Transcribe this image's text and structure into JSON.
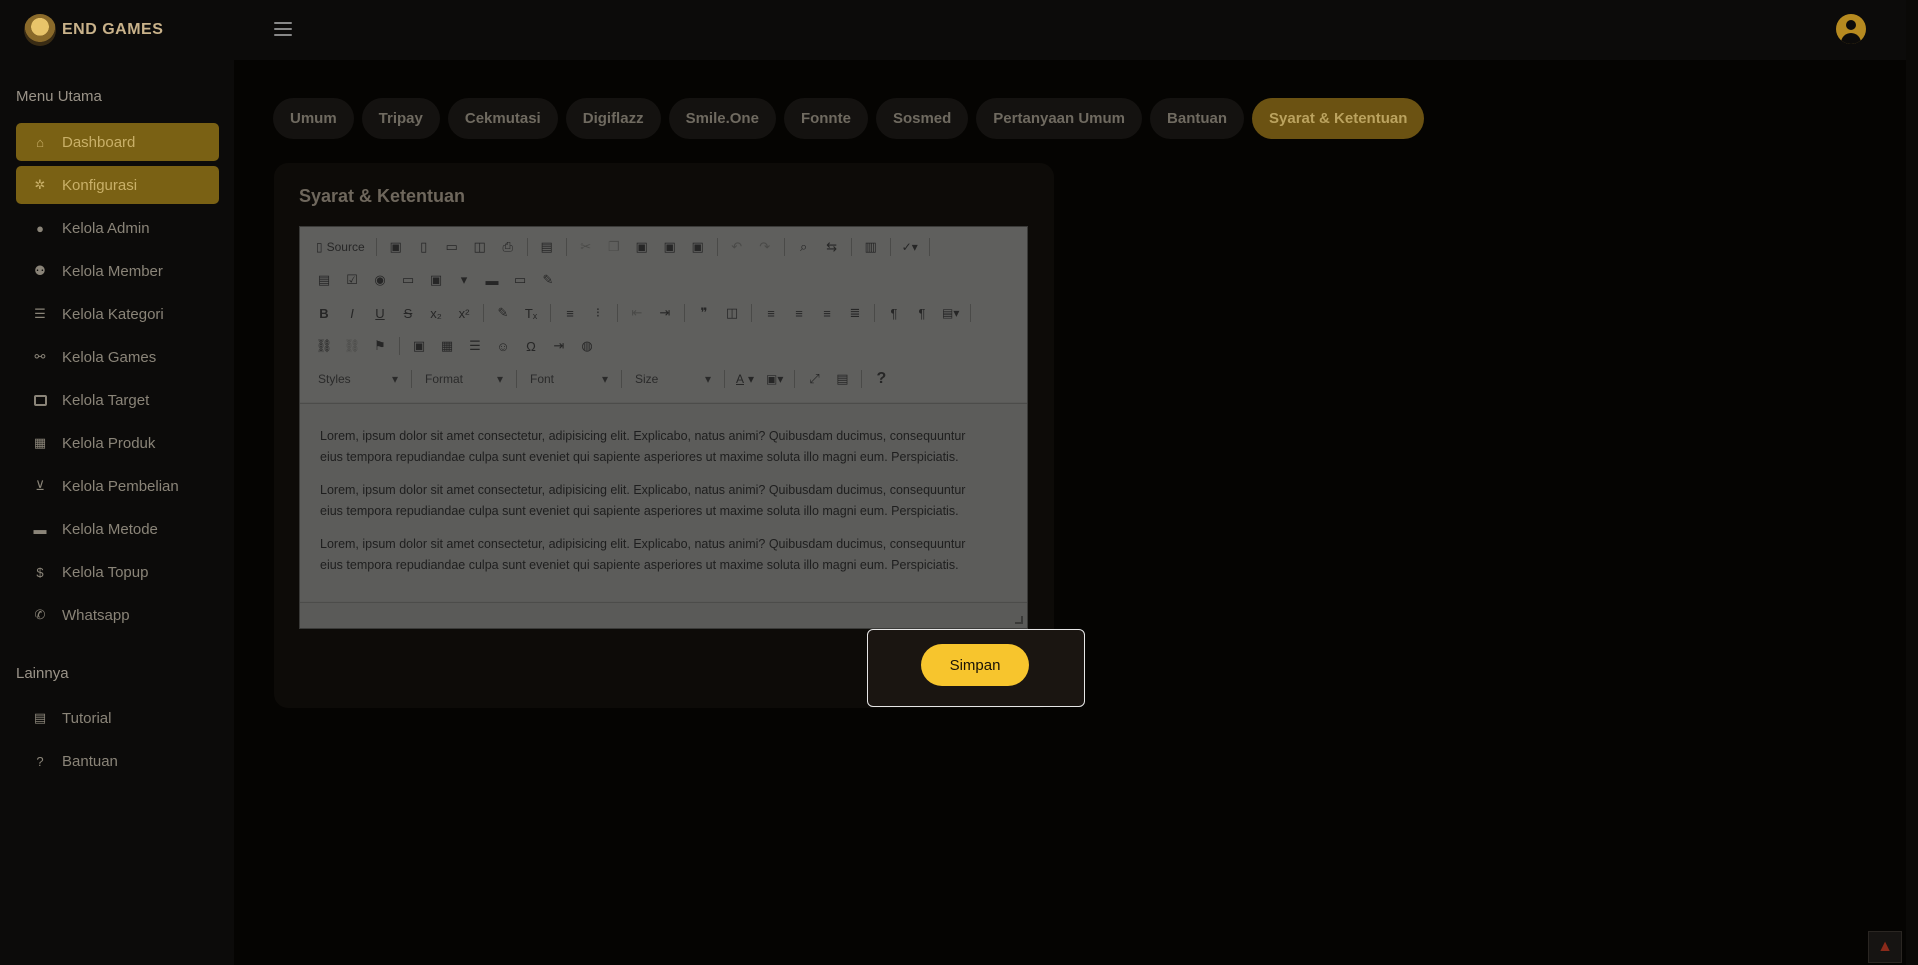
{
  "brand": {
    "name": "END GAMES"
  },
  "sidebar": {
    "heading_main": "Menu Utama",
    "heading_other": "Lainnya",
    "items": [
      {
        "label": "Dashboard",
        "icon": "home-icon"
      },
      {
        "label": "Konfigurasi",
        "icon": "gear-icon"
      },
      {
        "label": "Kelola Admin",
        "icon": "user-cog-icon"
      },
      {
        "label": "Kelola Member",
        "icon": "users-icon"
      },
      {
        "label": "Kelola Kategori",
        "icon": "list-icon"
      },
      {
        "label": "Kelola Games",
        "icon": "gamepad-icon"
      },
      {
        "label": "Kelola Target",
        "icon": "table-icon"
      },
      {
        "label": "Kelola Produk",
        "icon": "calendar-icon"
      },
      {
        "label": "Kelola Pembelian",
        "icon": "basket-icon"
      },
      {
        "label": "Kelola Metode",
        "icon": "credit-card-icon"
      },
      {
        "label": "Kelola Topup",
        "icon": "dollar-icon"
      },
      {
        "label": "Whatsapp",
        "icon": "whatsapp-icon"
      }
    ],
    "other_items": [
      {
        "label": "Tutorial",
        "icon": "book-icon"
      },
      {
        "label": "Bantuan",
        "icon": "question-icon"
      }
    ]
  },
  "tabs": [
    "Umum",
    "Tripay",
    "Cekmutasi",
    "Digiflazz",
    "Smile.One",
    "Fonnte",
    "Sosmed",
    "Pertanyaan Umum",
    "Bantuan",
    "Syarat & Ketentuan"
  ],
  "active_tab": "Syarat & Ketentuan",
  "card": {
    "title": "Syarat & Ketentuan"
  },
  "editor": {
    "source_label": "Source",
    "styles_label": "Styles",
    "format_label": "Format",
    "font_label": "Font",
    "size_label": "Size",
    "paragraphs": [
      "Lorem, ipsum dolor sit amet consectetur, adipisicing elit. Explicabo, natus animi? Quibusdam ducimus, consequuntur eius tempora repudiandae culpa sunt eveniet qui sapiente asperiores ut maxime soluta illo magni eum. Perspiciatis.",
      "Lorem, ipsum dolor sit amet consectetur, adipisicing elit. Explicabo, natus animi? Quibusdam ducimus, consequuntur eius tempora repudiandae culpa sunt eveniet qui sapiente asperiores ut maxime soluta illo magni eum. Perspiciatis.",
      "Lorem, ipsum dolor sit amet consectetur, adipisicing elit. Explicabo, natus animi? Quibusdam ducimus, consequuntur eius tempora repudiandae culpa sunt eveniet qui sapiente asperiores ut maxime soluta illo magni eum. Perspiciatis."
    ]
  },
  "save_button": "Simpan",
  "colors": {
    "accent": "#f7c52d",
    "background": "#050402",
    "panel": "#0c0b0a"
  }
}
